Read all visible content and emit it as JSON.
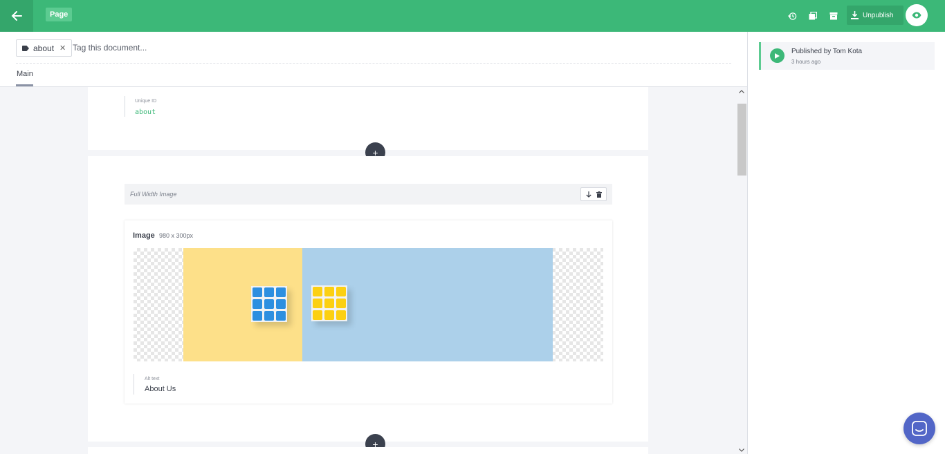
{
  "topbar": {
    "document_type": "Page",
    "unpublish_label": "Unpublish",
    "accent_color": "#3cb878"
  },
  "tags": {
    "chips": [
      {
        "label": "about"
      }
    ],
    "placeholder": "Tag this document..."
  },
  "tabs": [
    {
      "label": "Main",
      "active": true
    }
  ],
  "fields": {
    "uid": {
      "label": "Unique ID",
      "value": "about"
    }
  },
  "slice": {
    "title": "Full Width Image",
    "image": {
      "label": "Image",
      "dimensions": "980 x 300px",
      "alt_label": "Alt text",
      "alt_value": "About Us"
    }
  },
  "history": {
    "items": [
      {
        "title": "Published by Tom Kota",
        "time": "3 hours ago"
      }
    ]
  },
  "icons": [
    "arrow-left-icon",
    "history-icon",
    "duplicate-icon",
    "archive-icon",
    "download-icon",
    "eye-icon",
    "tag-icon",
    "close-icon",
    "plus-icon",
    "arrow-down-icon",
    "trash-icon",
    "play-icon",
    "chat-icon",
    "scroll-up-icon",
    "scroll-down-icon"
  ]
}
